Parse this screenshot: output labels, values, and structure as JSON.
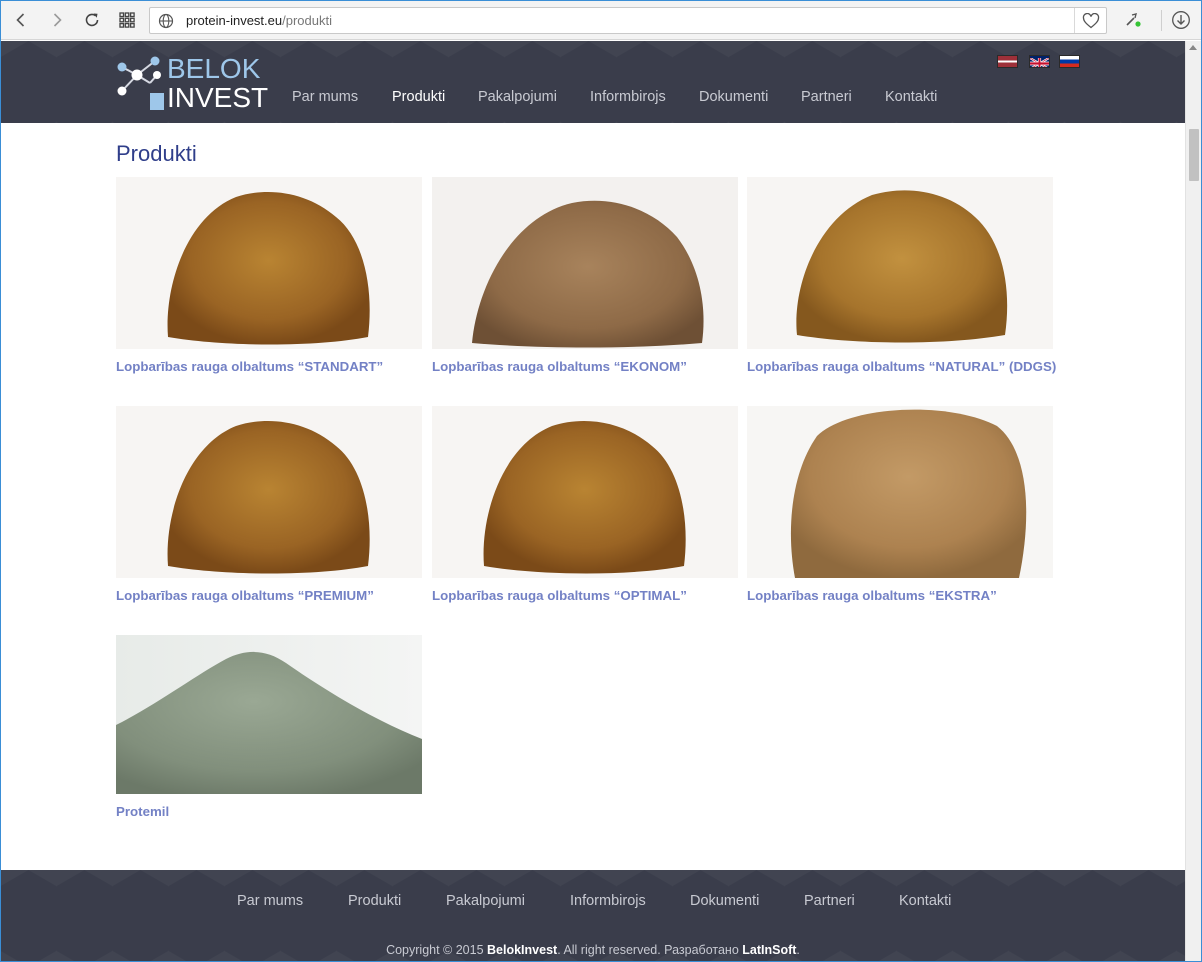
{
  "browser": {
    "url_host": "protein-invest.eu",
    "url_path": "/produkti",
    "icons": [
      "back-icon",
      "forward-icon",
      "reload-icon",
      "speed-dial-icon",
      "globe-icon",
      "heart-icon",
      "extensions-icon",
      "download-icon"
    ]
  },
  "header": {
    "logo_line1": "BELOK",
    "logo_line2": "INVEST",
    "nav": [
      {
        "label": "Par mums",
        "active": false
      },
      {
        "label": "Produkti",
        "active": true
      },
      {
        "label": "Pakalpojumi",
        "active": false
      },
      {
        "label": "Informbirojs",
        "active": false
      },
      {
        "label": "Dokumenti",
        "active": false
      },
      {
        "label": "Partneri",
        "active": false
      },
      {
        "label": "Kontakti",
        "active": false
      }
    ],
    "languages": [
      "lv-flag",
      "en-flag",
      "ru-flag"
    ]
  },
  "main": {
    "title": "Produkti",
    "products": [
      {
        "name": "Lopbarības rauga olbaltums “STANDART”",
        "image": "brown-powder-pile"
      },
      {
        "name": "Lopbarības rauga olbaltums “EKONOM”",
        "image": "coarse-brown-powder-pile"
      },
      {
        "name": "Lopbarības rauga olbaltums “NATURAL” (DDGS)",
        "image": "golden-powder-pile"
      },
      {
        "name": "Lopbarības rauga olbaltums “PREMIUM”",
        "image": "brown-powder-pile"
      },
      {
        "name": "Lopbarības rauga olbaltums “OPTIMAL”",
        "image": "brown-powder-pile"
      },
      {
        "name": "Lopbarības rauga olbaltums “EKSTRA”",
        "image": "light-brown-powder-heap"
      },
      {
        "name": "Protemil",
        "image": "grey-green-powder-pile"
      }
    ]
  },
  "footer": {
    "nav": [
      "Par mums",
      "Produkti",
      "Pakalpojumi",
      "Informbirojs",
      "Dokumenti",
      "Partneri",
      "Kontakti"
    ],
    "copyright_prefix": "Copyright © 2015 ",
    "copyright_company": "BelokInvest",
    "copyright_middle": ". All right reserved. Разработано ",
    "copyright_developer": "LatInSoft",
    "copyright_suffix": "."
  }
}
